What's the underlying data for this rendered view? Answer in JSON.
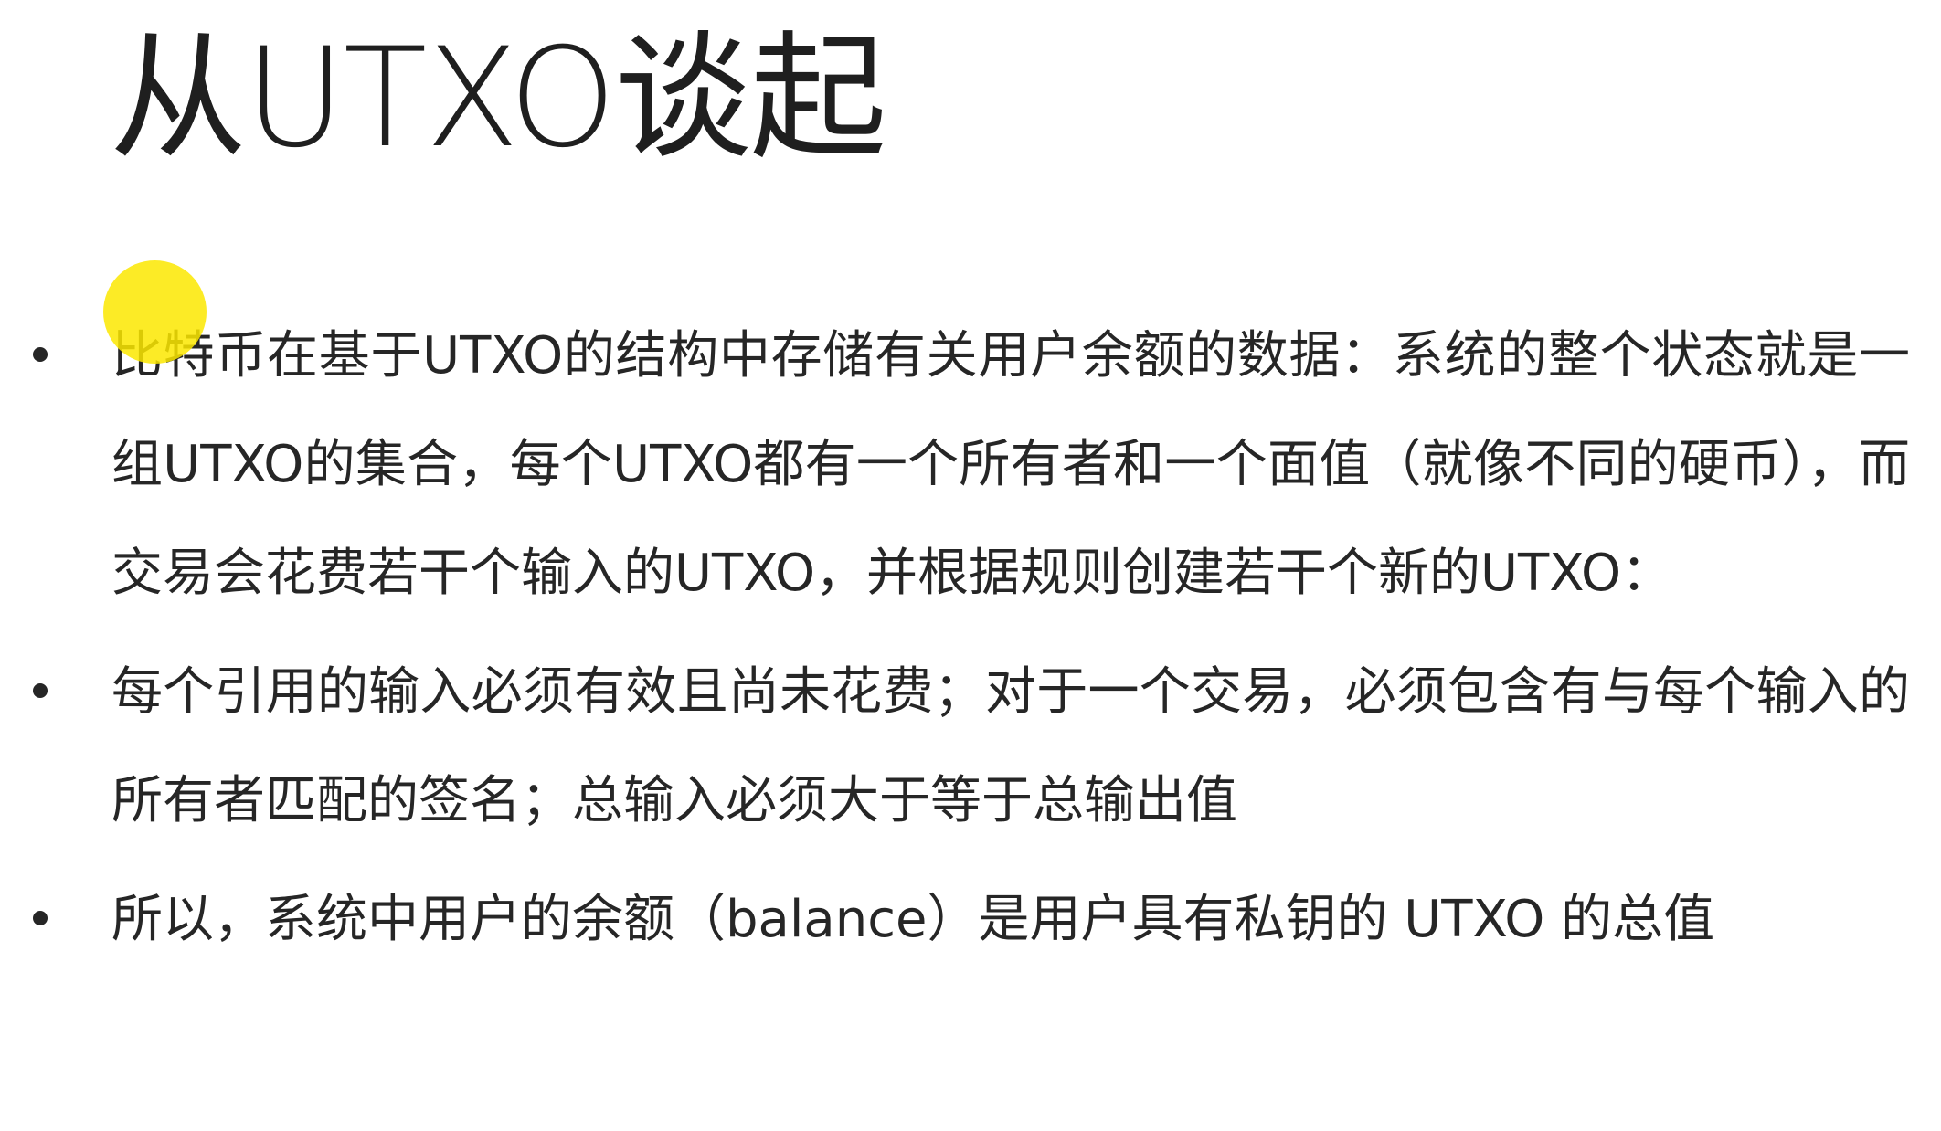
{
  "slide": {
    "title": "从UTXO谈起",
    "bullets": [
      "比特币在基于UTXO的结构中存储有关用户余额的数据：系统的整个状态就是一组UTXO的集合，每个UTXO都有一个所有者和一个面值（就像不同的硬币），而交易会花费若干个输入的UTXO，并根据规则创建若干个新的UTXO：",
      "每个引用的输入必须有效且尚未花费；对于一个交易，必须包含有与每个输入的所有者匹配的签名；总输入必须大于等于总输出值",
      "所以，系统中用户的余额（balance）是用户具有私钥的 UTXO 的总值"
    ]
  },
  "colors": {
    "text": "#262626",
    "pointer_highlight": "#fce800",
    "background": "#ffffff"
  }
}
